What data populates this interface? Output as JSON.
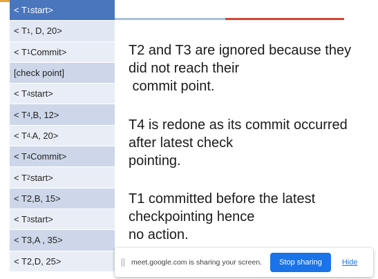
{
  "log": {
    "rows": [
      {
        "prefix": "< T",
        "sub": "1",
        "suffix": " start>"
      },
      {
        "prefix": "< T",
        "sub": "1",
        "suffix": ", D, 20>"
      },
      {
        "prefix": "< T",
        "sub": "1",
        "suffix": " Commit>"
      },
      {
        "prefix": "[check point]",
        "sub": "",
        "suffix": ""
      },
      {
        "prefix": "< T",
        "sub": "4",
        "suffix": " start>"
      },
      {
        "prefix": "< T",
        "sub": "4",
        "suffix": ",B, 12>"
      },
      {
        "prefix": "< T",
        "sub": "4,",
        "suffix": " A, 20>"
      },
      {
        "prefix": "< T",
        "sub": "4",
        "suffix": " Commit>"
      },
      {
        "prefix": "< T",
        "sub": "2",
        "suffix": " start>"
      },
      {
        "prefix": "< T2,B, 15>",
        "sub": "",
        "suffix": ""
      },
      {
        "prefix": "< T",
        "sub": "3",
        "suffix": " start>"
      },
      {
        "prefix": "< T3,A , 35>",
        "sub": "",
        "suffix": ""
      },
      {
        "prefix": "< T2,D, 25>",
        "sub": "",
        "suffix": ""
      }
    ]
  },
  "notes": {
    "block1": [
      "T2  and T3 are ignored because they",
      "did not reach their",
      " commit point."
    ],
    "block2": [
      "T4 is redone as its commit occurred",
      "after latest check",
      "pointing."
    ],
    "block3": [
      "T1 committed before the latest",
      "checkpointing hence",
      "no action."
    ]
  },
  "share_bar": {
    "message": "meet.google.com is sharing your screen.",
    "stop_label": "Stop sharing",
    "hide_label": "Hide"
  },
  "colors": {
    "header_row": "#4a76be",
    "row_dark": "#cdd7e9",
    "row_light": "#e9eef6",
    "accent_orange": "#e8a33a",
    "accent_blue": "#a8c0dd",
    "accent_red": "#d2452f",
    "button_blue": "#1a73e8"
  }
}
